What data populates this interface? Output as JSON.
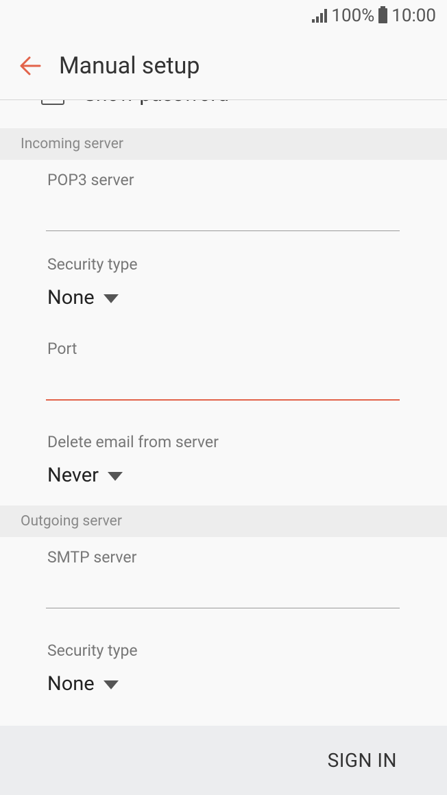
{
  "status_bar": {
    "battery_percent": "100%",
    "time": "10:00"
  },
  "app_bar": {
    "title": "Manual setup",
    "accent_color": "#e2634a"
  },
  "account": {
    "show_password_label": "Show password"
  },
  "incoming_server": {
    "header": "Incoming server",
    "server_label": "POP3 server",
    "server_value": "",
    "security_label": "Security type",
    "security_value": "None",
    "port_label": "Port",
    "port_value": "",
    "delete_label": "Delete email from server",
    "delete_value": "Never"
  },
  "outgoing_server": {
    "header": "Outgoing server",
    "server_label": "SMTP server",
    "server_value": "",
    "security_label": "Security type",
    "security_value": "None"
  },
  "footer": {
    "sign_in_label": "SIGN IN"
  }
}
